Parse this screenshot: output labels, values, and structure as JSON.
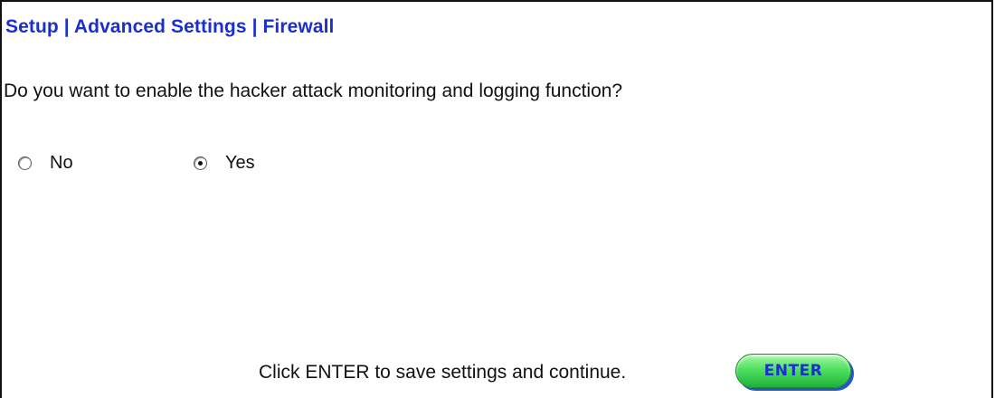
{
  "header": {
    "breadcrumb": "Setup | Advanced Settings | Firewall"
  },
  "form": {
    "question": "Do you want to enable the hacker attack monitoring and logging function?",
    "options": [
      {
        "label": "No",
        "checked": false
      },
      {
        "label": "Yes",
        "checked": true
      }
    ]
  },
  "footer": {
    "instruction": "Click ENTER to save settings and continue.",
    "enter_label": "ENTER"
  },
  "colors": {
    "link_blue": "#1a2fcf",
    "button_green": "#4fe060"
  }
}
